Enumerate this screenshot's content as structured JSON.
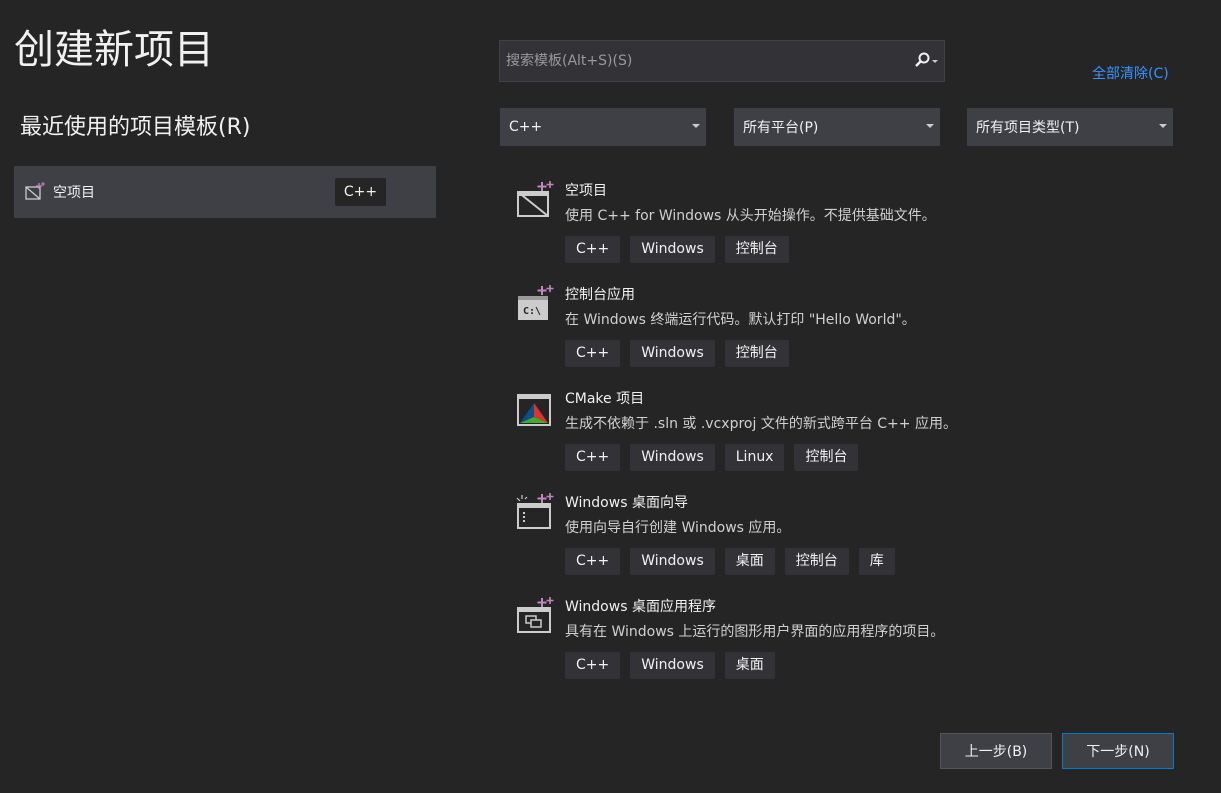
{
  "title": "创建新项目",
  "recent": {
    "heading": "最近使用的项目模板(R)",
    "items": [
      {
        "name": "空项目",
        "tag": "C++",
        "icon": "empty-project-icon"
      }
    ]
  },
  "search": {
    "placeholder": "搜索模板(Alt+S)(S)",
    "value": "",
    "icon": "search-icon"
  },
  "clear_all": "全部清除(C)",
  "filters": {
    "language": "C++",
    "platform": "所有平台(P)",
    "project_type": "所有项目类型(T)"
  },
  "templates": [
    {
      "name": "空项目",
      "description": "使用 C++ for Windows 从头开始操作。不提供基础文件。",
      "tags": [
        "C++",
        "Windows",
        "控制台"
      ],
      "icon": "empty-project-icon"
    },
    {
      "name": "控制台应用",
      "description": "在 Windows 终端运行代码。默认打印 \"Hello World\"。",
      "tags": [
        "C++",
        "Windows",
        "控制台"
      ],
      "icon": "console-app-icon"
    },
    {
      "name": "CMake 项目",
      "description": "生成不依赖于 .sln 或 .vcxproj 文件的新式跨平台 C++ 应用。",
      "tags": [
        "C++",
        "Windows",
        "Linux",
        "控制台"
      ],
      "icon": "cmake-icon"
    },
    {
      "name": "Windows 桌面向导",
      "description": "使用向导自行创建 Windows 应用。",
      "tags": [
        "C++",
        "Windows",
        "桌面",
        "控制台",
        "库"
      ],
      "icon": "desktop-wizard-icon"
    },
    {
      "name": "Windows 桌面应用程序",
      "description": "具有在 Windows 上运行的图形用户界面的应用程序的项目。",
      "tags": [
        "C++",
        "Windows",
        "桌面"
      ],
      "icon": "desktop-app-icon"
    }
  ],
  "buttons": {
    "back": "上一步(B)",
    "next": "下一步(N)"
  },
  "colors": {
    "background": "#252526",
    "accent_link": "#3794ff",
    "selected_border": "#007acc",
    "sparkle": "#c586c0"
  }
}
